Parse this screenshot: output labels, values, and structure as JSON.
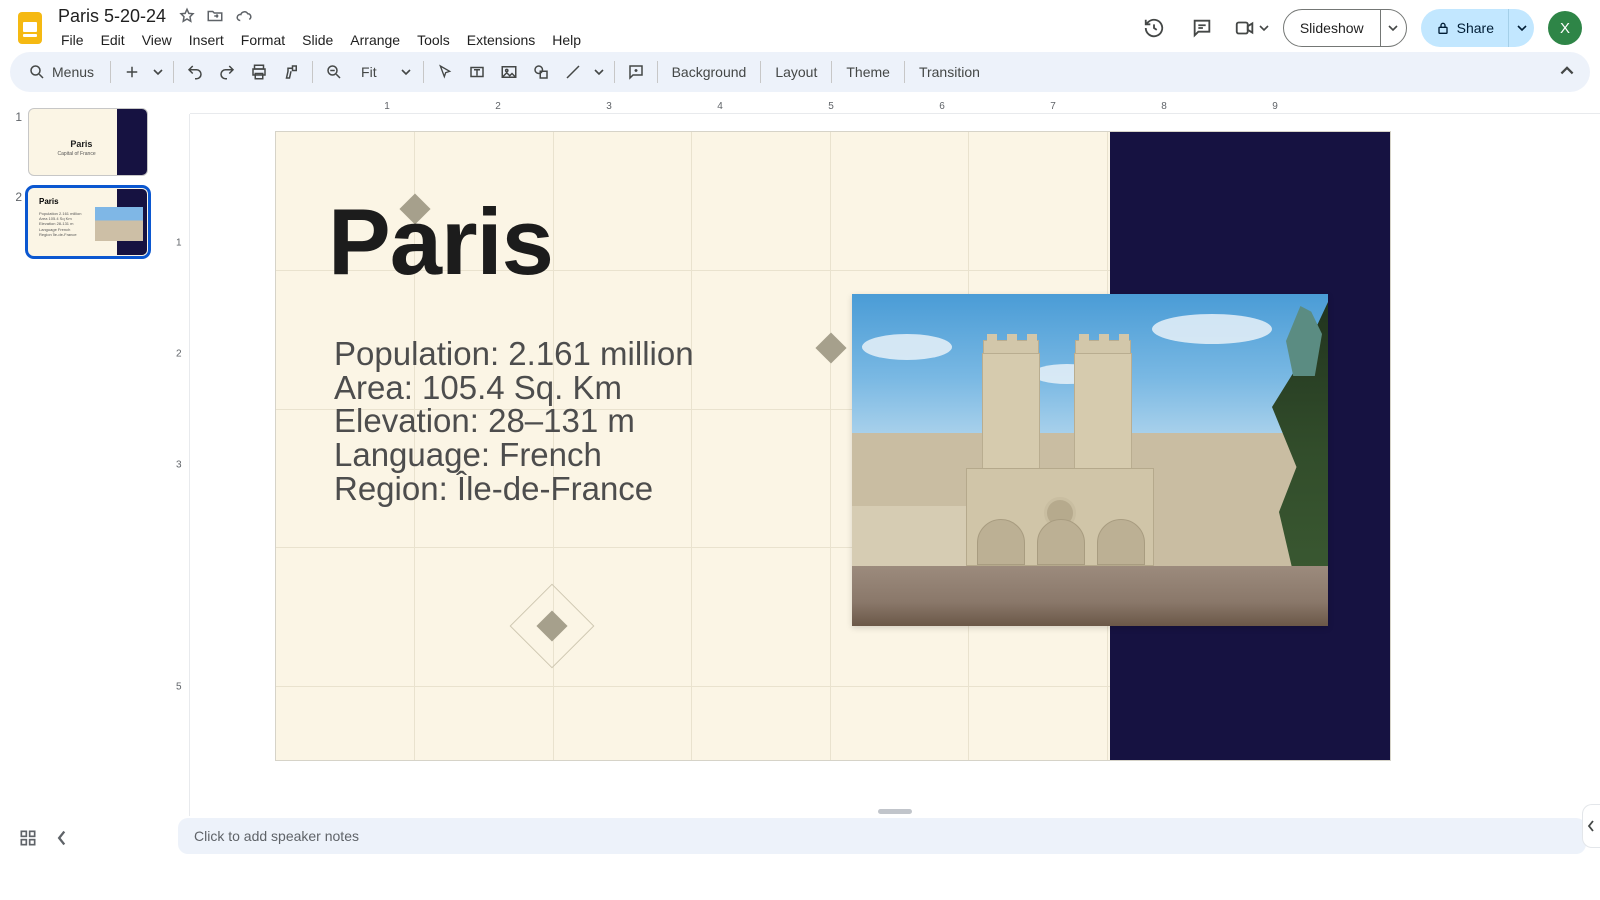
{
  "doc": {
    "title": "Paris 5-20-24"
  },
  "menus": [
    "File",
    "Edit",
    "View",
    "Insert",
    "Format",
    "Slide",
    "Arrange",
    "Tools",
    "Extensions",
    "Help"
  ],
  "toolbarMenusLabel": "Menus",
  "zoom": "Fit",
  "toolbarText": {
    "background": "Background",
    "layout": "Layout",
    "theme": "Theme",
    "transition": "Transition"
  },
  "header": {
    "slideshow": "Slideshow",
    "share": "Share",
    "avatar": "X"
  },
  "thumbs": [
    {
      "num": "1",
      "title": "Paris",
      "subtitle": "Capital of France"
    },
    {
      "num": "2",
      "title": "Paris"
    }
  ],
  "slide": {
    "title": "Paris",
    "facts": [
      "Population: 2.161 million",
      "Area: 105.4 Sq. Km",
      "Elevation: 28–131 m",
      "Language: French",
      "Region: Île-de-France"
    ]
  },
  "notesPlaceholder": "Click to add speaker notes",
  "rulerH": [
    "1",
    "2",
    "3",
    "4",
    "5",
    "6",
    "7",
    "8",
    "9"
  ],
  "rulerV": [
    "1",
    "2",
    "3",
    "5"
  ]
}
